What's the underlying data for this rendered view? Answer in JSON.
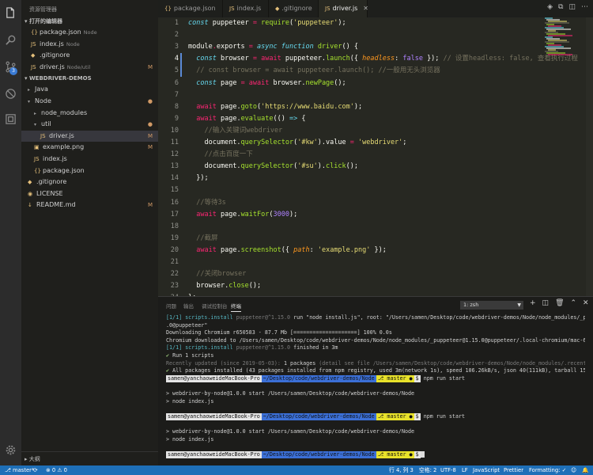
{
  "sidebar": {
    "title": "资源管理器",
    "open_editors_title": "打开的编辑器",
    "open_editors": [
      {
        "name": "package.json",
        "desc": "Node",
        "icon": "{}",
        "status": ""
      },
      {
        "name": "index.js",
        "desc": "Node",
        "icon": "JS",
        "status": ""
      },
      {
        "name": ".gitignore",
        "desc": "",
        "icon": "◆",
        "status": ""
      },
      {
        "name": "driver.js",
        "desc": "Node/util",
        "icon": "JS",
        "status": "M"
      }
    ],
    "workspace_title": "WEBDRIVER-DEMOS",
    "tree": [
      {
        "name": "Java",
        "twisty": "▸",
        "icon": "",
        "status": "",
        "indent": 0
      },
      {
        "name": "Node",
        "twisty": "▾",
        "icon": "",
        "status": "●",
        "indent": 0
      },
      {
        "name": "node_modules",
        "twisty": "▸",
        "icon": "",
        "status": "",
        "indent": 1
      },
      {
        "name": "util",
        "twisty": "▾",
        "icon": "",
        "status": "●",
        "indent": 1
      },
      {
        "name": "driver.js",
        "twisty": "",
        "icon": "JS",
        "status": "M",
        "indent": 2
      },
      {
        "name": "example.png",
        "twisty": "",
        "icon": "▣",
        "status": "M",
        "indent": 1
      },
      {
        "name": "index.js",
        "twisty": "",
        "icon": "JS",
        "status": "",
        "indent": 1
      },
      {
        "name": "package.json",
        "twisty": "",
        "icon": "{}",
        "status": "",
        "indent": 1
      },
      {
        "name": ".gitignore",
        "twisty": "",
        "icon": "◆",
        "status": "",
        "indent": 0
      },
      {
        "name": "LICENSE",
        "twisty": "",
        "icon": "◉",
        "status": "",
        "indent": 0
      },
      {
        "name": "README.md",
        "twisty": "",
        "icon": "↓",
        "status": "M",
        "indent": 0
      }
    ],
    "outline_title": "大纲"
  },
  "tabs": [
    {
      "label": "package.json",
      "icon": "{}"
    },
    {
      "label": "index.js",
      "icon": "JS"
    },
    {
      "label": ".gitignore",
      "icon": "◆"
    },
    {
      "label": "driver.js",
      "icon": "JS"
    }
  ],
  "editor": {
    "active_line": 4,
    "lines": [
      [
        [
          "kw",
          "const "
        ],
        [
          "",
          "puppeteer "
        ],
        [
          "kp",
          "= "
        ],
        [
          "fn",
          "require"
        ],
        [
          "",
          "("
        ],
        [
          "str",
          "'puppeteer'"
        ],
        [
          "",
          "); "
        ]
      ],
      [],
      [
        [
          "",
          "module"
        ],
        [
          "kp",
          "."
        ],
        [
          "",
          "exports "
        ],
        [
          "kp",
          "= "
        ],
        [
          "kw",
          "async function "
        ],
        [
          "fn",
          "driver"
        ],
        [
          "",
          "() {"
        ]
      ],
      [
        [
          "",
          "  "
        ],
        [
          "kw",
          "const "
        ],
        [
          "",
          "browser "
        ],
        [
          "kp",
          "= await "
        ],
        [
          "",
          "puppeteer."
        ],
        [
          "fn",
          "launch"
        ],
        [
          "",
          "({ "
        ],
        [
          "prm",
          "headless"
        ],
        [
          "",
          ": "
        ],
        [
          "num",
          "false "
        ],
        [
          "",
          "}); "
        ],
        [
          "cm",
          "// 设置headless: false, 查看执行过程"
        ]
      ],
      [
        [
          "",
          "  "
        ],
        [
          "cm",
          "// const browser = await puppeteer.launch(); //一般用无头浏览器"
        ]
      ],
      [
        [
          "",
          "  "
        ],
        [
          "kw",
          "const "
        ],
        [
          "",
          "page "
        ],
        [
          "kp",
          "= await "
        ],
        [
          "",
          "browser."
        ],
        [
          "fn",
          "newPage"
        ],
        [
          "",
          "();"
        ]
      ],
      [],
      [
        [
          "",
          "  "
        ],
        [
          "kp",
          "await "
        ],
        [
          "",
          "page."
        ],
        [
          "fn",
          "goto"
        ],
        [
          "",
          "("
        ],
        [
          "str",
          "'https://www.baidu.com'"
        ],
        [
          "",
          ");"
        ]
      ],
      [
        [
          "",
          "  "
        ],
        [
          "kp",
          "await "
        ],
        [
          "",
          "page."
        ],
        [
          "fn",
          "evaluate"
        ],
        [
          "",
          "(() "
        ],
        [
          "kw",
          "=> "
        ],
        [
          "",
          "{"
        ]
      ],
      [
        [
          "",
          "    "
        ],
        [
          "cm",
          "//输入关键词webdriver"
        ]
      ],
      [
        [
          "",
          "    "
        ],
        [
          "",
          "document."
        ],
        [
          "fn",
          "querySelector"
        ],
        [
          "",
          "("
        ],
        [
          "str",
          "'#kw'"
        ],
        [
          "",
          ").value "
        ],
        [
          "kp",
          "= "
        ],
        [
          "str",
          "'webdriver'"
        ],
        [
          "",
          ";"
        ]
      ],
      [
        [
          "",
          "    "
        ],
        [
          "cm",
          "//点击百度一下"
        ]
      ],
      [
        [
          "",
          "    "
        ],
        [
          "",
          "document."
        ],
        [
          "fn",
          "querySelector"
        ],
        [
          "",
          "("
        ],
        [
          "str",
          "'#su'"
        ],
        [
          "",
          ")."
        ],
        [
          "fn",
          "click"
        ],
        [
          "",
          "();"
        ]
      ],
      [
        [
          "",
          "  "
        ],
        [
          "",
          "});"
        ]
      ],
      [],
      [
        [
          "",
          "  "
        ],
        [
          "cm",
          "//等待3s"
        ]
      ],
      [
        [
          "",
          "  "
        ],
        [
          "kp",
          "await "
        ],
        [
          "",
          "page."
        ],
        [
          "fn",
          "waitFor"
        ],
        [
          "",
          "("
        ],
        [
          "num",
          "3000"
        ],
        [
          "",
          ");"
        ]
      ],
      [],
      [
        [
          "",
          "  "
        ],
        [
          "cm",
          "//截屏"
        ]
      ],
      [
        [
          "",
          "  "
        ],
        [
          "kp",
          "await "
        ],
        [
          "",
          "page."
        ],
        [
          "fn",
          "screenshot"
        ],
        [
          "",
          "({ "
        ],
        [
          "prm",
          "path"
        ],
        [
          "",
          ": "
        ],
        [
          "str",
          "'example.png' "
        ],
        [
          "",
          "});"
        ]
      ],
      [],
      [
        [
          "",
          "  "
        ],
        [
          "cm",
          "//关闭browser"
        ]
      ],
      [
        [
          "",
          "  "
        ],
        [
          "",
          "browser."
        ],
        [
          "fn",
          "close"
        ],
        [
          "",
          "();"
        ]
      ],
      [
        [
          "",
          "};"
        ]
      ]
    ]
  },
  "panel": {
    "tabs": [
      "问题",
      "输出",
      "调试控制台",
      "终端"
    ],
    "active_tab": 3,
    "terminal_select": "1: zsh",
    "lines": [
      [
        [
          "t-cyan",
          "[1/1] scripts.install "
        ],
        [
          "t-dim",
          "puppeteer@^1.15.0 "
        ],
        [
          "",
          "run \"node install.js\", root: \"/Users/samen/Desktop/code/webdriver-demos/Node/node_modules/_puppeteer@1.15"
        ]
      ],
      [
        [
          "",
          ".0@puppeteer\""
        ]
      ],
      [
        [
          "",
          "Downloading Chromium r650583 - 87.7 Mb [====================] 100% 0.0s"
        ]
      ],
      [
        [
          "",
          "Chromium downloaded to /Users/samen/Desktop/code/webdriver-demos/Node/node_modules/_puppeteer@1.15.0@puppeteer/.local-chromium/mac-650583"
        ]
      ],
      [
        [
          "t-cyan",
          "[1/1] scripts.install "
        ],
        [
          "t-dim",
          "puppeteer@^1.15.0 "
        ],
        [
          "",
          "finished in 3m"
        ]
      ],
      [
        [
          "t-green",
          "✔ "
        ],
        [
          "",
          "Run 1 scripts"
        ]
      ],
      [
        [
          "t-dim",
          "Recently updated (since 2019-05-03): "
        ],
        [
          "",
          "1 packages "
        ],
        [
          "t-dim",
          "(detail see file /Users/samen/Desktop/code/webdriver-demos/Node/node_modules/.recently_updates.txt)"
        ]
      ],
      [
        [
          "t-green",
          "✔ "
        ],
        [
          "",
          "All packages installed (43 packages installed from npm registry, used 3m(network 1s), speed 106.26kB/s, json 40(111kB), tarball 15.66kB)"
        ]
      ],
      [
        [
          "prompt",
          "samen@yanchaoweideMacBook-Pro"
        ],
        [
          "path",
          "~/Desktop/code/webdriver-demos/Node"
        ],
        [
          "git",
          "⎇ master ●"
        ],
        [
          "tail",
          "$"
        ],
        [
          "",
          " npm run start"
        ]
      ],
      [],
      [
        [
          "",
          "> webdriver-by-node@1.0.0 start /Users/samen/Desktop/code/webdriver-demos/Node"
        ]
      ],
      [
        [
          "",
          "> node index.js"
        ]
      ],
      [],
      [
        [
          "prompt",
          "samen@yanchaoweideMacBook-Pro"
        ],
        [
          "path",
          "~/Desktop/code/webdriver-demos/Node"
        ],
        [
          "git",
          "⎇ master ●"
        ],
        [
          "tail",
          "$"
        ],
        [
          "",
          " npm run start"
        ]
      ],
      [],
      [
        [
          "",
          "> webdriver-by-node@1.0.0 start /Users/samen/Desktop/code/webdriver-demos/Node"
        ]
      ],
      [
        [
          "",
          "> node index.js"
        ]
      ],
      [],
      [
        [
          "prompt",
          "samen@yanchaoweideMacBook-Pro"
        ],
        [
          "path",
          "~/Desktop/code/webdriver-demos/Node"
        ],
        [
          "git",
          "⎇ master ●"
        ],
        [
          "tail",
          "$"
        ],
        [
          "cursor",
          ""
        ]
      ]
    ]
  },
  "statusbar": {
    "branch": "master*",
    "sync": "⟳",
    "errors": "0",
    "warnings": "0",
    "cursor_pos": "行 4, 列 3",
    "spaces": "空格: 2",
    "encoding": "UTF-8",
    "eol": "LF",
    "language": "JavaScript",
    "prettier": "Prettier",
    "formatting": "Formatting: ✓"
  },
  "colors": {
    "accent": "#1e6fb8",
    "editor_bg": "#272822",
    "sidebar_bg": "#1f1f1c"
  }
}
